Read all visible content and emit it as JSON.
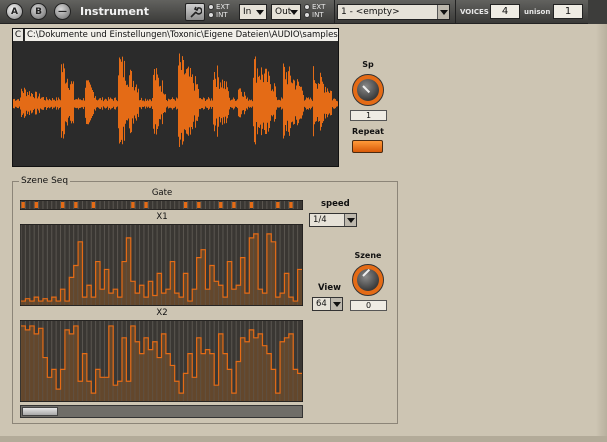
{
  "header": {
    "btn_a": "A",
    "btn_b": "B",
    "btn_minus": "—",
    "title": "Instrument",
    "ext_label": "EXT",
    "int_label": "INT",
    "in_label": "In",
    "out_label": "Out",
    "preset_value": "1 - <empty>",
    "voices_label": "VOICES",
    "voices_value": "4",
    "unison_label": "unison",
    "unison_value": "1"
  },
  "sample": {
    "c_label": "C",
    "path": "C:\\Dokumente und Einstellungen\\Toxonic\\Eigene Dateien\\AUDIO\\samples"
  },
  "controls": {
    "sp_label": "Sp",
    "sp_value": "1",
    "repeat_label": "Repeat",
    "szene_label": "Szene",
    "szene_value": "0",
    "speed_label": "speed",
    "speed_value": "1/4",
    "view_label": "View",
    "view_value": "64"
  },
  "seq": {
    "title": "Szene Seq",
    "gate_label": "Gate",
    "x1_label": "X1",
    "x2_label": "X2",
    "gate_steps": [
      1,
      0,
      0,
      1,
      0,
      0,
      0,
      0,
      0,
      1,
      0,
      0,
      1,
      0,
      0,
      0,
      1,
      0,
      0,
      0,
      0,
      0,
      0,
      0,
      0,
      1,
      0,
      0,
      1,
      0,
      0,
      0,
      0,
      0,
      0,
      0,
      0,
      1,
      0,
      0,
      1,
      0,
      0,
      0,
      0,
      1,
      0,
      0,
      1,
      0,
      0,
      0,
      1,
      0,
      0,
      0,
      0,
      0,
      1,
      0,
      0,
      1,
      0,
      0
    ],
    "x1_values": [
      0.05,
      0.08,
      0.05,
      0.1,
      0.05,
      0.08,
      0.05,
      0.1,
      0.05,
      0.2,
      0.05,
      0.35,
      0.5,
      0.8,
      0.1,
      0.25,
      0.1,
      0.55,
      0.2,
      0.45,
      0.15,
      0.2,
      0.1,
      0.55,
      0.85,
      0.3,
      0.15,
      0.25,
      0.1,
      0.3,
      0.12,
      0.4,
      0.15,
      0.2,
      0.55,
      0.15,
      0.1,
      0.4,
      0.05,
      0.2,
      0.6,
      0.7,
      0.2,
      0.5,
      0.3,
      0.25,
      0.1,
      0.55,
      0.2,
      0.25,
      0.6,
      0.15,
      0.85,
      0.9,
      0.2,
      0.15,
      0.9,
      0.8,
      0.1,
      0.15,
      0.4,
      0.1,
      0.05,
      0.45
    ],
    "x2_values": [
      0.95,
      0.9,
      0.95,
      0.85,
      0.92,
      0.55,
      0.3,
      0.4,
      0.15,
      0.4,
      0.9,
      0.85,
      0.95,
      0.25,
      0.6,
      0.25,
      0.1,
      0.4,
      0.3,
      0.3,
      0.95,
      0.2,
      0.25,
      0.8,
      0.25,
      0.95,
      0.75,
      0.6,
      0.8,
      0.65,
      0.75,
      0.55,
      0.85,
      0.6,
      0.45,
      0.25,
      0.1,
      0.35,
      0.6,
      0.3,
      0.8,
      0.6,
      0.65,
      0.6,
      0.2,
      0.85,
      0.6,
      0.4,
      0.1,
      0.5,
      0.8,
      0.75,
      0.9,
      0.8,
      0.85,
      0.7,
      0.6,
      0.4,
      0.1,
      0.75,
      0.8,
      0.85,
      0.4,
      0.35
    ],
    "scroll_position": 0
  },
  "colors": {
    "accent": "#e46b16",
    "panel_bg": "#cdc5b3",
    "display_bg": "#2b2b2b"
  }
}
